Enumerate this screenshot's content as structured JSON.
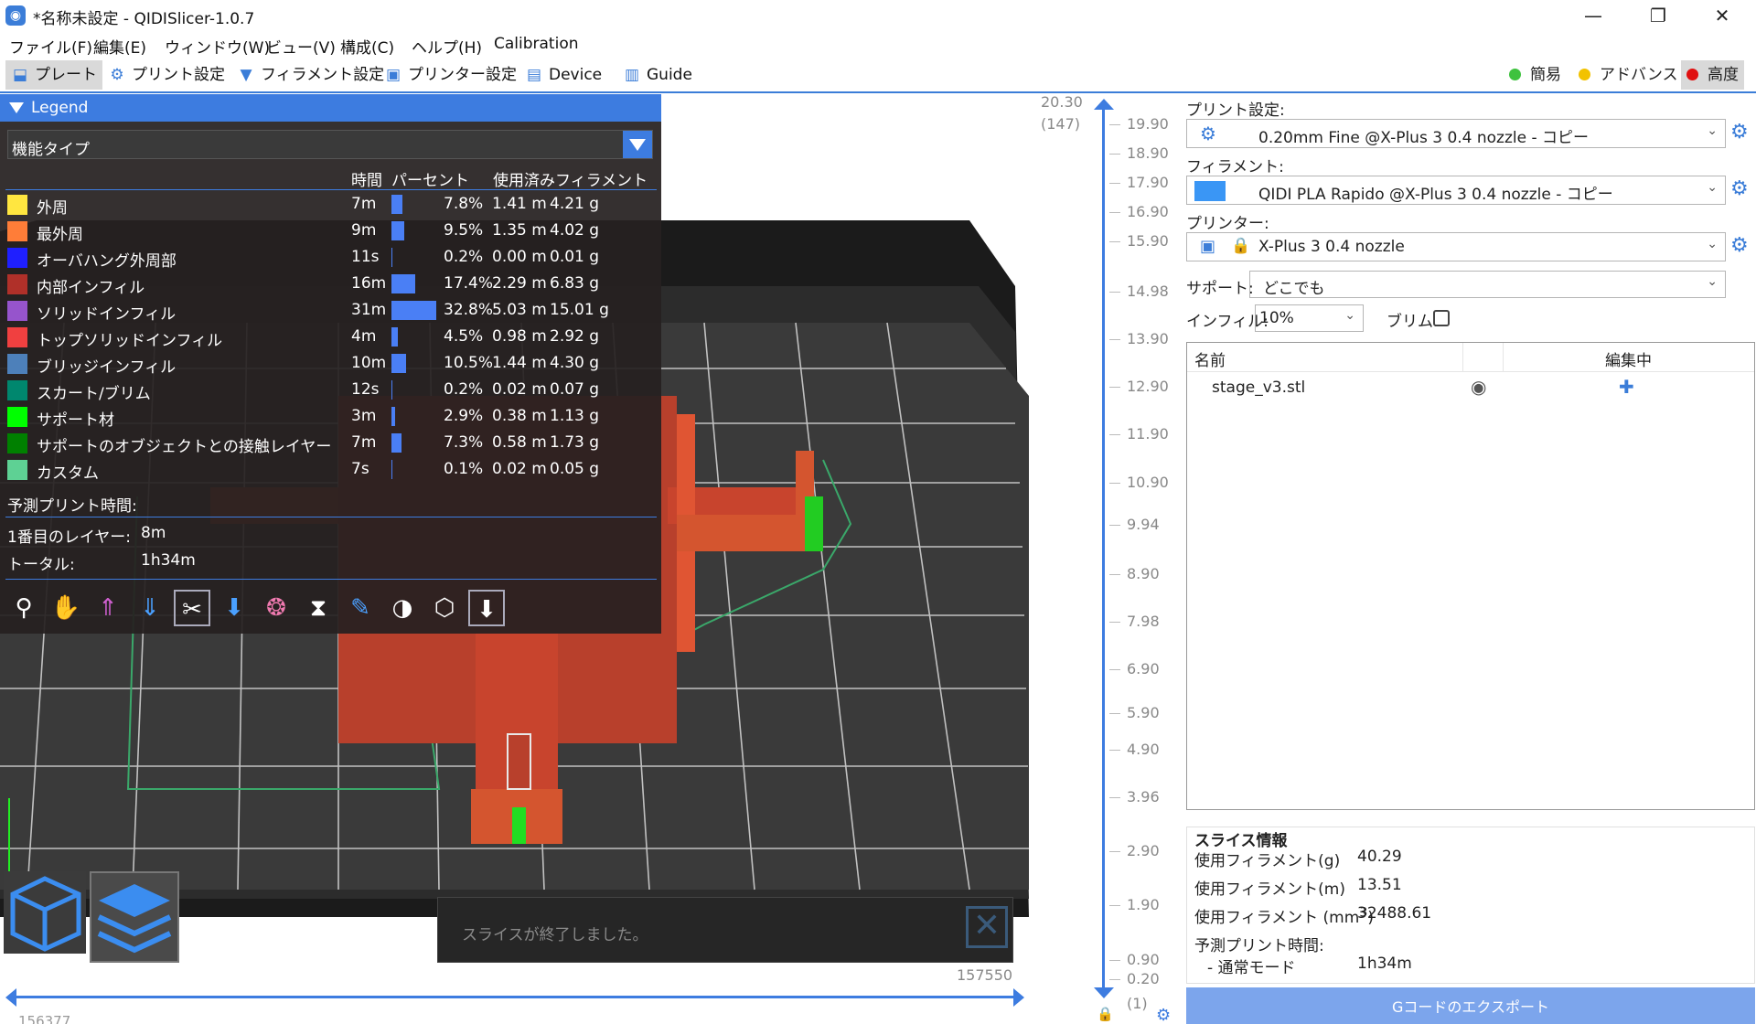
{
  "window": {
    "title": "*名称未設定 - QIDISlicer-1.0.7",
    "minimize": "—",
    "maximize": "❐",
    "close": "✕"
  },
  "menu": [
    "ファイル(F)",
    "編集(E)",
    "ウィンドウ(W)",
    "ビュー(V)",
    "構成(C)",
    "ヘルプ(H)",
    "Calibration"
  ],
  "tabs": [
    {
      "label": "プレート",
      "icon": "plate-icon"
    },
    {
      "label": "プリント設定",
      "icon": "gear-icon"
    },
    {
      "label": "フィラメント設定",
      "icon": "filament-icon"
    },
    {
      "label": "プリンター設定",
      "icon": "printer-icon"
    },
    {
      "label": "Device",
      "icon": "device-icon"
    },
    {
      "label": "Guide",
      "icon": "guide-icon"
    }
  ],
  "modes": [
    {
      "label": "簡易",
      "color": "#3ec23e"
    },
    {
      "label": "アドバンスド",
      "color": "#f2c200"
    },
    {
      "label": "高度",
      "color": "#e01010"
    }
  ],
  "legend": {
    "title": "Legend",
    "view_type": "機能タイプ",
    "columns": {
      "time": "時間",
      "percent": "パーセント",
      "used": "使用済みフィラメント"
    },
    "rows": [
      {
        "name": "外周",
        "color": "#ffe640",
        "time": "7m",
        "percent": "7.8%",
        "length": "1.41 m",
        "weight": "4.21 g",
        "fraction": 0.078
      },
      {
        "name": "最外周",
        "color": "#ff7d38",
        "time": "9m",
        "percent": "9.5%",
        "length": "1.35 m",
        "weight": "4.02 g",
        "fraction": 0.095
      },
      {
        "name": "オーバハング外周部",
        "color": "#1f1fff",
        "time": "11s",
        "percent": "0.2%",
        "length": "0.00 m",
        "weight": "0.01 g",
        "fraction": 0.002
      },
      {
        "name": "内部インフィル",
        "color": "#b03029",
        "time": "16m",
        "percent": "17.4%",
        "length": "2.29 m",
        "weight": "6.83 g",
        "fraction": 0.174
      },
      {
        "name": "ソリッドインフィル",
        "color": "#9654cc",
        "time": "31m",
        "percent": "32.8%",
        "length": "5.03 m",
        "weight": "15.01 g",
        "fraction": 0.328
      },
      {
        "name": "トップソリッドインフィル",
        "color": "#f04040",
        "time": "4m",
        "percent": "4.5%",
        "length": "0.98 m",
        "weight": "2.92 g",
        "fraction": 0.045
      },
      {
        "name": "ブリッジインフィル",
        "color": "#4d80ba",
        "time": "10m",
        "percent": "10.5%",
        "length": "1.44 m",
        "weight": "4.30 g",
        "fraction": 0.105
      },
      {
        "name": "スカート/ブリム",
        "color": "#00876e",
        "time": "12s",
        "percent": "0.2%",
        "length": "0.02 m",
        "weight": "0.07 g",
        "fraction": 0.002
      },
      {
        "name": "サポート材",
        "color": "#00ff00",
        "time": "3m",
        "percent": "2.9%",
        "length": "0.38 m",
        "weight": "1.13 g",
        "fraction": 0.029
      },
      {
        "name": "サポートのオブジェクトとの接触レイヤー",
        "color": "#008000",
        "time": "7m",
        "percent": "7.3%",
        "length": "0.58 m",
        "weight": "1.73 g",
        "fraction": 0.073
      },
      {
        "name": "カスタム",
        "color": "#5ed194",
        "time": "7s",
        "percent": "0.1%",
        "length": "0.02 m",
        "weight": "0.05 g",
        "fraction": 0.001
      }
    ],
    "estimated_label": "予測プリント時間:",
    "first_layer_label": "1番目のレイヤー:",
    "first_layer_value": "8m",
    "total_label": "トータル:",
    "total_value": "1h34m",
    "view_icons": [
      "legend-options-icon",
      "travel-icon",
      "wipe-icon",
      "retractions-icon",
      "deretractions-icon",
      "seams-icon",
      "tool-changes-icon",
      "color-changes-icon",
      "pause-icon",
      "custom-gcode-icon",
      "center-of-gravity-icon",
      "shells-icon",
      "tool-marker-icon"
    ]
  },
  "viewport": {
    "status": "スライスが終了しました。",
    "h_slider_max": "157550",
    "h_slider_min": "156377"
  },
  "vslider": {
    "top_value": "20.30",
    "top_layer": "(147)",
    "ticks": [
      "19.90",
      "18.90",
      "17.90",
      "16.90",
      "15.90",
      "14.98",
      "13.90",
      "12.90",
      "11.90",
      "10.90",
      "9.94",
      "8.90",
      "7.98",
      "6.90",
      "5.90",
      "4.90",
      "3.96",
      "2.90",
      "1.90",
      "0.90",
      "0.20"
    ],
    "bottom_layer": "(1)"
  },
  "sidebar": {
    "print_label": "プリント設定:",
    "print_value": "0.20mm Fine @X-Plus 3 0.4 nozzle - コピー",
    "filament_label": "フィラメント:",
    "filament_value": "QIDI PLA Rapido @X-Plus 3 0.4 nozzle - コピー",
    "filament_color": "#3a96f5",
    "printer_label": "プリンター:",
    "printer_value": "X-Plus 3 0.4 nozzle",
    "support_label": "サポート:",
    "support_value": "どこでも",
    "infill_label": "インフィル:",
    "infill_value": "10%",
    "brim_label": "ブリム:",
    "brim_checked": false,
    "objects": {
      "col_name": "名前",
      "col_editing": "編集中",
      "items": [
        {
          "name": "stage_v3.stl"
        }
      ]
    },
    "slice_info": {
      "title": "スライス情報",
      "filament_g_label": "使用フィラメント(g)",
      "filament_g": "40.29",
      "filament_m_label": "使用フィラメント(m)",
      "filament_m": "13.51",
      "filament_mm3_label": "使用フィラメント (mm",
      "filament_mm3_sup": "3",
      "filament_mm3_close": ")",
      "filament_mm3": "32488.61",
      "est_label": "予測プリント時間:",
      "normal_label": "- 通常モード",
      "normal_value": "1h34m"
    },
    "export_label": "Gコードのエクスポート"
  }
}
